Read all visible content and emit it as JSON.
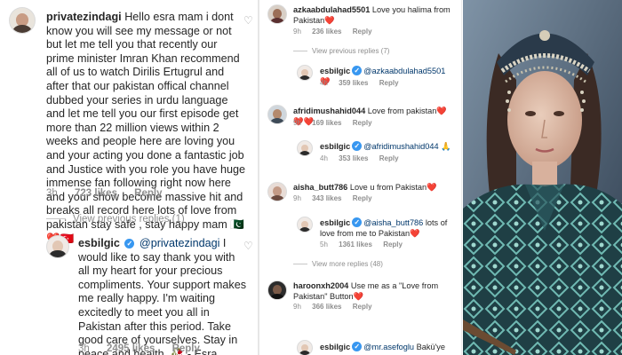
{
  "left": {
    "comment1": {
      "username": "privatezindagi",
      "text": "Hello esra mam i dont know you will see my message or not but let me tell you that recently our prime minister Imran Khan recommend all of us to watch Dirilis Ertugrul and after that our pakistan offical channel dubbed your series in urdu language and let me tell you our first episode get more than 22 million views within 2 weeks and people here are loving you and your acting you done a fantastic job and Justice with you role you have huge immense fan following right now here and your show become massive hit and breaks all record here lots of love from pakistan stay safe , stay happy mam",
      "emoji": "🇵🇰❤️🇹🇷",
      "time": "3h",
      "likes": "723 likes",
      "reply": "Reply"
    },
    "view_replies": "View previous replies (1)",
    "comment2": {
      "username": "esbilgic",
      "mention": "@privatezindagi",
      "text": "I would like to say thank you with all my heart for your precious compliments. Your support makes me really happy. I'm waiting excitedly to meet you all in Pakistan after this period. Take good care of yourselves. Stay in peace and health. 🥀 - Esra",
      "time": "3h",
      "likes": "2495 likes",
      "reply": "Reply"
    }
  },
  "middle": {
    "c1": {
      "username": "azkaabdulahad5501",
      "text": "Love you halima from Pakistan",
      "emoji": "❤️",
      "time": "9h",
      "likes": "236 likes",
      "reply": "Reply"
    },
    "view1": "View previous replies (7)",
    "r1": {
      "username": "esbilgic",
      "mention": "@azkaabdulahad5501",
      "emoji": "❤️",
      "time": "4h",
      "likes": "359 likes",
      "reply": "Reply"
    },
    "c2": {
      "username": "afridimushahid044",
      "text": "Love from pakistan",
      "emoji": "❤️❤️❤️",
      "time": "9h",
      "likes": "169 likes",
      "reply": "Reply"
    },
    "r2": {
      "username": "esbilgic",
      "mention": "@afridimushahid044",
      "emoji": "🙏",
      "time": "4h",
      "likes": "353 likes",
      "reply": "Reply"
    },
    "c3": {
      "username": "aisha_butt786",
      "text": "Love u from Pakistan",
      "emoji": "❤️",
      "time": "9h",
      "likes": "343 likes",
      "reply": "Reply"
    },
    "r3": {
      "username": "esbilgic",
      "mention": "@aisha_butt786",
      "text": "lots of love from me to Pakistan",
      "emoji": "❤️",
      "time": "5h",
      "likes": "1361 likes",
      "reply": "Reply"
    },
    "view2": "View more replies (48)",
    "c4": {
      "username": "haroonxh2004",
      "text": "Use me as a \"Love from Pakistan\" Button",
      "emoji": "❤️",
      "time": "9h",
      "likes": "366 likes",
      "reply": "Reply"
    },
    "r4": {
      "username": "esbilgic",
      "mention": "@mr.asefoglu",
      "text": "Bakü'ye"
    }
  },
  "icons": {
    "heart": "heart-icon",
    "verified": "verified-badge-icon"
  },
  "colors": {
    "mention": "#00376b",
    "muted": "#8e8e8e",
    "verified": "#3897f0",
    "heart": "#ed4956"
  }
}
